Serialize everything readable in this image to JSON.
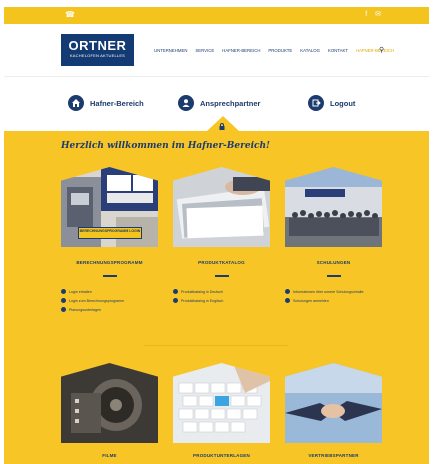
{
  "topbar": {
    "phone_icon": "phone-icon",
    "social": [
      "f",
      "✉"
    ]
  },
  "logo": {
    "name": "ORTNER",
    "tagline": "KACHELOFEN AKTUELLES"
  },
  "nav": {
    "items": [
      "UNTERNEHMEN",
      "SERVICE",
      "HAFNER-BEREICH",
      "PRODUKTE",
      "KATALOG",
      "KONTAKT"
    ],
    "active": "Hafner-Bereich",
    "search_icon": "search-icon"
  },
  "subnav": {
    "hafner": "Hafner-Bereich",
    "ansprech": "Ansprechpartner",
    "logout": "Logout"
  },
  "welcome": "Herzlich willkommen im Hafner-Bereich!",
  "cards": [
    {
      "title": "Berechnungsprogramm",
      "overlay": "BERECHNUNGSPROGRAMM LOGIN",
      "links": [
        "Login erhalten",
        "Login zum Berechnungsprogramm",
        "Planungsunterlagen"
      ]
    },
    {
      "title": "Produktkatalog",
      "links": [
        "Produktkatalog in Deutsch",
        "Produktkatalog in Englisch"
      ]
    },
    {
      "title": "Schulungen",
      "links": [
        "Informationen über unsere Schulungsinhalte",
        "Schulungen anmelden"
      ]
    },
    {
      "title": "Filme"
    },
    {
      "title": "Produktunterlagen"
    },
    {
      "title": "Vertriebspartner"
    }
  ],
  "colors": {
    "primary": "#1c3b6e",
    "accent": "#f7c525"
  }
}
